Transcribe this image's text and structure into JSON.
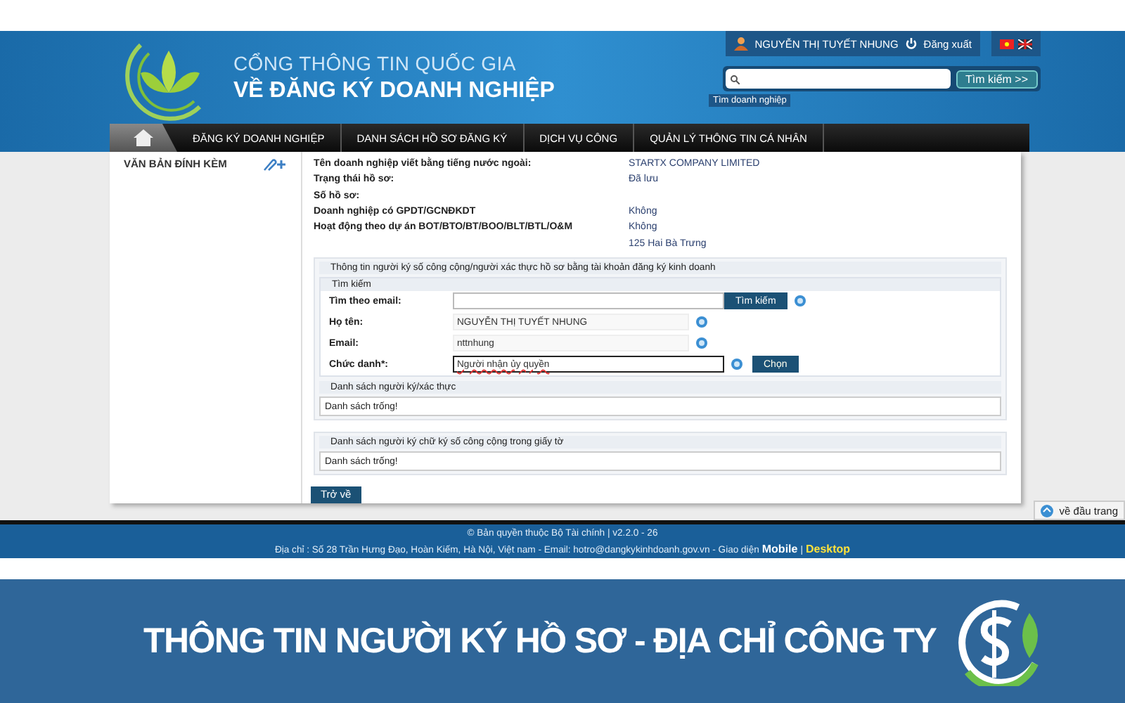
{
  "header": {
    "portal_line1": "CỔNG THÔNG TIN QUỐC GIA",
    "portal_line2": "VỀ ĐĂNG KÝ DOANH NGHIỆP",
    "user_name": "NGUYỄN THỊ TUYẾT NHUNG",
    "logout": "Đăng xuất",
    "search_button": "Tìm kiếm >>",
    "search_tooltip": "Tìm doanh nghiệp"
  },
  "nav": {
    "home_selected": true,
    "items": [
      {
        "label": "ĐĂNG KÝ DOANH NGHIỆP",
        "selected": false
      },
      {
        "label": "DANH SÁCH HỒ SƠ ĐĂNG KÝ",
        "selected": false
      },
      {
        "label": "DỊCH VỤ CÔNG",
        "selected": false
      },
      {
        "label": "QUẢN LÝ THÔNG TIN CÁ NHÂN",
        "selected": false
      }
    ]
  },
  "sidebar_title": "VĂN BẢN ĐÍNH KÈM",
  "info_rows": [
    {
      "label": "Tên doanh nghiệp viết bằng tiếng nước ngoài:",
      "value": "STARTX COMPANY LIMITED"
    },
    {
      "label": "Trạng thái hồ sơ:",
      "value": "Đã lưu"
    },
    {
      "label": "Số hồ sơ:"
    },
    {
      "label": "Doanh nghiệp có GPDT/GCNĐKDT",
      "value": "Không"
    },
    {
      "label": "Hoạt động theo dự án BOT/BTO/BT/BOO/BLT/BTL/O&M",
      "value": "Không"
    },
    {
      "value": "125 Hai Bà Trưng"
    }
  ],
  "signer": {
    "title": "Thông tin người ký số công cộng/người xác thực hồ sơ bằng tài khoản đăng ký kinh doanh",
    "search_title": "Tìm kiếm",
    "fields": [
      {
        "label": "Tìm theo email:",
        "kind": "search",
        "button": "Tìm kiếm"
      },
      {
        "label": "Họ tên:",
        "kind": "readonly",
        "value": "NGUYỄN THỊ TUYẾT NHUNG"
      },
      {
        "label": "Email:",
        "kind": "readonly",
        "value": "nttnhung"
      },
      {
        "label": "Chức danh*:",
        "kind": "focused",
        "value": "Người nhận ủy quyền",
        "button": "Chọn"
      }
    ]
  },
  "lists": [
    {
      "title": "Danh sách người ký/xác thực",
      "empty_text": "Danh sách trống!"
    },
    {
      "title": "Danh sách người ký chữ ký số công cộng trong giấy tờ",
      "empty_text": "Danh sách trống!"
    }
  ],
  "back_button": "Trở về",
  "scroll_top": "về đầu trang",
  "footer": {
    "copyright": "© Bản quyền thuộc Bộ Tài chính | v2.2.0 - 26",
    "address": "Địa chỉ : Số 28 Trần Hưng Đạo, Hoàn Kiếm, Hà Nội, Việt nam - Email: hotro@dangkykinhdoanh.gov.vn - Giao diện",
    "mobile": "Mobile",
    "separator": "|",
    "desktop": "Desktop"
  },
  "banner": {
    "title": "THÔNG TIN NGƯỜI KÝ HỒ SƠ - ĐỊA CHỈ CÔNG TY"
  }
}
